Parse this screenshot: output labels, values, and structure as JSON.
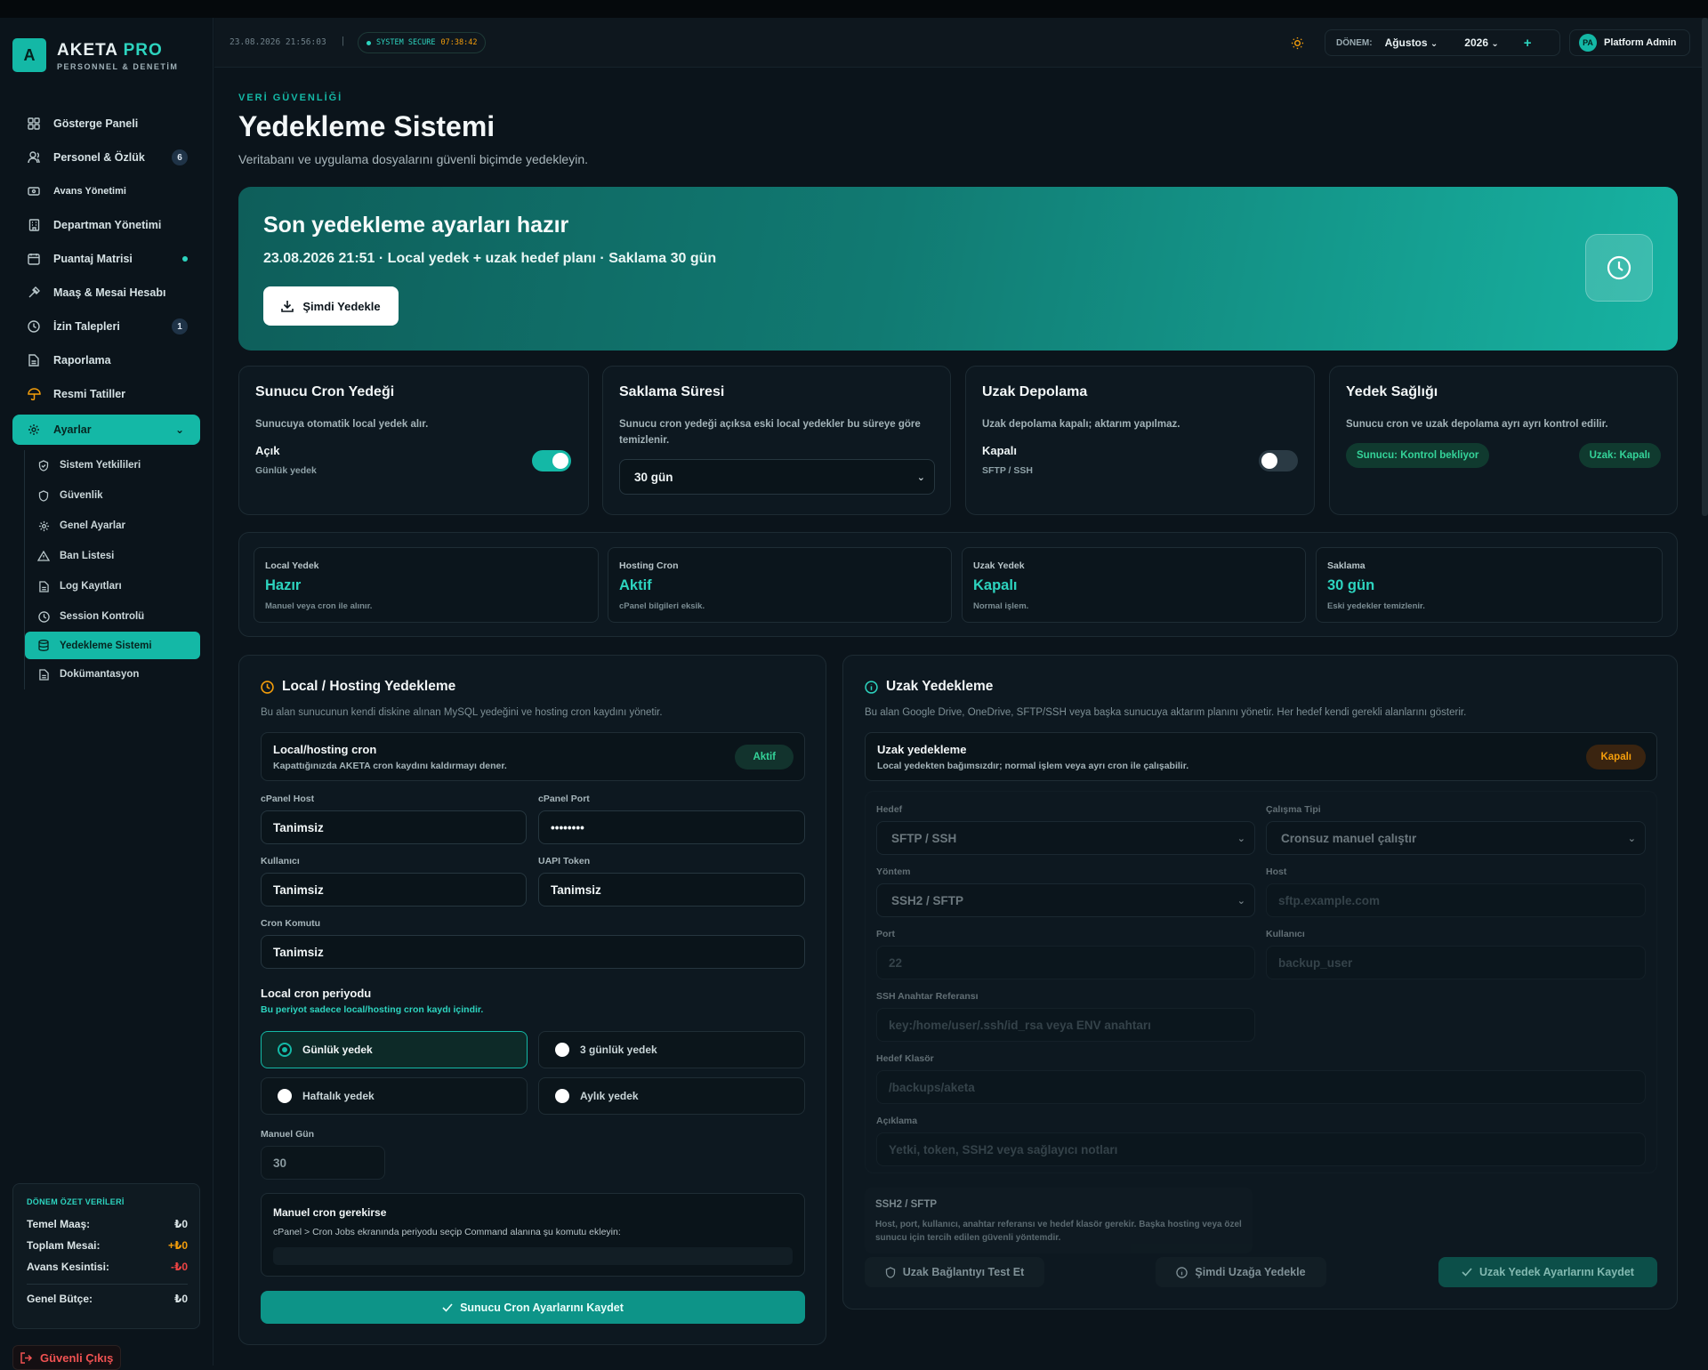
{
  "app": {
    "logo_letter": "A",
    "brand_name": "AKETA",
    "brand_pro": "PRO",
    "brand_sub": "PERSONNEL & DENETİM"
  },
  "sidebar": {
    "items": [
      {
        "label": "Gösterge Paneli",
        "icon": "grid-icon"
      },
      {
        "label": "Personel & Özlük",
        "icon": "users-icon",
        "badge": "6"
      },
      {
        "label": "Avans Yönetimi",
        "icon": "wallet-icon"
      },
      {
        "label": "Departman Yönetimi",
        "icon": "building-icon"
      },
      {
        "label": "Puantaj Matrisi",
        "icon": "calendar-icon"
      },
      {
        "label": "Maaş & Mesai Hesabı",
        "icon": "calculator-icon"
      },
      {
        "label": "İzin Talepleri",
        "icon": "clock-icon",
        "badge": "1"
      },
      {
        "label": "Raporlama",
        "icon": "file-icon"
      },
      {
        "label": "Resmi Tatiller",
        "icon": "umbrella-icon"
      },
      {
        "label": "Ayarlar",
        "icon": "gear-icon",
        "chevron": "⌄"
      }
    ],
    "sub_items": [
      {
        "label": "Sistem Yetkilileri",
        "icon": "shield-icon"
      },
      {
        "label": "Güvenlik",
        "icon": "shield-icon"
      },
      {
        "label": "Genel Ayarlar",
        "icon": "gear-icon"
      },
      {
        "label": "Ban Listesi",
        "icon": "warning-icon"
      },
      {
        "label": "Log Kayıtları",
        "icon": "file-icon"
      },
      {
        "label": "Session Kontrolü",
        "icon": "clock-icon"
      },
      {
        "label": "Yedekleme Sistemi",
        "icon": "database-icon"
      },
      {
        "label": "Dokümantasyon",
        "icon": "file-icon"
      }
    ],
    "summary": {
      "title": "DÖNEM ÖZET VERİLERİ",
      "rows": [
        {
          "label": "Temel Maaş:",
          "value": "₺0",
          "color": "#e6eef0"
        },
        {
          "label": "Toplam Mesai:",
          "value": "+₺0",
          "color": "#f59e0b"
        },
        {
          "label": "Avans Kesintisi:",
          "value": "-₺0",
          "color": "#ef4444"
        }
      ],
      "total_label": "Genel Bütçe:",
      "total_value": "₺0"
    },
    "logout": "Güvenli Çıkış"
  },
  "header": {
    "datetime": "23.08.2026 21:56:03",
    "separator": "|",
    "secure_label": "SYSTEM SECURE",
    "secure_timer": "07:38:42",
    "period_label": "DÖNEM:",
    "month": "Ağustos",
    "year": "2026",
    "plus": "+",
    "avatar": "PA",
    "user": "Platform Admin"
  },
  "page": {
    "kicker": "VERİ GÜVENLİĞİ",
    "title": "Yedekleme Sistemi",
    "subtitle": "Veritabanı ve uygulama dosyalarını güvenli biçimde yedekleyin."
  },
  "hero": {
    "title": "Son yedekleme ayarları hazır",
    "subtitle": "23.08.2026 21:51 · Local yedek + uzak hedef planı · Saklama 30 gün",
    "button": "Şimdi Yedekle"
  },
  "cards": {
    "cron": {
      "title": "Sunucu Cron Yedeği",
      "desc": "Sunucuya otomatik local yedek alır.",
      "status": "Açık",
      "status_sub": "Günlük yedek",
      "toggle_on": true
    },
    "retention": {
      "title": "Saklama Süresi",
      "desc": "Sunucu cron yedeği açıksa eski local yedekler bu süreye göre temizlenir.",
      "select": "30 gün"
    },
    "remote": {
      "title": "Uzak Depolama",
      "desc": "Uzak depolama kapalı; aktarım yapılmaz.",
      "status": "Kapalı",
      "status_sub": "SFTP / SSH",
      "toggle_on": false
    },
    "health": {
      "title": "Yedek Sağlığı",
      "desc": "Sunucu cron ve uzak depolama ayrı ayrı kontrol edilir.",
      "pill1": "Sunucu: Kontrol bekliyor",
      "pill2": "Uzak: Kapalı"
    }
  },
  "stats": [
    {
      "label": "Local Yedek",
      "value": "Hazır",
      "sub": "Manuel veya cron ile alınır."
    },
    {
      "label": "Hosting Cron",
      "value": "Aktif",
      "sub": "cPanel bilgileri eksik."
    },
    {
      "label": "Uzak Yedek",
      "value": "Kapalı",
      "sub": "Normal işlem."
    },
    {
      "label": "Saklama",
      "value": "30 gün",
      "sub": "Eski yedekler temizlenir."
    }
  ],
  "local": {
    "title": "Local / Hosting Yedekleme",
    "desc": "Bu alan sunucunun kendi diskine alınan MySQL yedeğini ve hosting cron kaydını yönetir.",
    "cron_box_title": "Local/hosting cron",
    "cron_box_desc": "Kapattığınızda AKETA cron kaydını kaldırmayı dener.",
    "cron_badge": "Aktif",
    "fields": {
      "cpanel_host_label": "cPanel Host",
      "cpanel_host": "Tanimsiz",
      "cpanel_port_label": "cPanel Port",
      "cpanel_port": "••••••••",
      "user_label": "Kullanıcı",
      "user": "Tanimsiz",
      "token_label": "UAPI Token",
      "token": "Tanimsiz",
      "command_label": "Cron Komutu",
      "command": "Tanimsiz"
    },
    "period_title": "Local cron periyodu",
    "period_desc": "Bu periyot sadece local/hosting cron kaydı içindir.",
    "options": [
      "Günlük yedek",
      "3 günlük yedek",
      "Haftalık yedek",
      "Aylık yedek"
    ],
    "manual_label": "Manuel Gün",
    "manual_value": "30",
    "manual_box_title": "Manuel cron gerekirse",
    "manual_box_desc": "cPanel > Cron Jobs ekranında periyodu seçip Command alanına şu komutu ekleyin:",
    "save": "Sunucu Cron Ayarlarını Kaydet"
  },
  "remote": {
    "title": "Uzak Yedekleme",
    "desc": "Bu alan Google Drive, OneDrive, SFTP/SSH veya başka sunucuya aktarım planını yönetir. Her hedef kendi gerekli alanlarını gösterir.",
    "box_title": "Uzak yedekleme",
    "box_desc": "Local yedekten bağımsızdır; normal işlem veya ayrı cron ile çalışabilir.",
    "badge": "Kapalı",
    "target_label": "Hedef",
    "target": "SFTP / SSH",
    "mode_label": "Çalışma Tipi",
    "mode": "Cronsuz manuel çalıştır",
    "method_label": "Yöntem",
    "method": "SSH2 / SFTP",
    "host_label": "Host",
    "host_ph": "sftp.example.com",
    "port_label": "Port",
    "port_ph": "22",
    "user_label": "Kullanıcı",
    "user_ph": "backup_user",
    "key_label": "SSH Anahtar Referansı",
    "key_ph": "key:/home/user/.ssh/id_rsa veya ENV anahtarı",
    "folder_label": "Hedef Klasör",
    "folder_ph": "/backups/aketa",
    "note_label": "Açıklama",
    "note_ph": "Yetki, token, SSH2 veya sağlayıcı notları",
    "info_title": "SSH2 / SFTP",
    "info_desc": "Host, port, kullanıcı, anahtar referansı ve hedef klasör gerekir. Başka hosting veya özel sunucu için tercih edilen güvenli yöntemdir.",
    "btn_test": "Uzak Bağlantıyı Test Et",
    "btn_backup": "Şimdi Uzağa Yedekle",
    "btn_save": "Uzak Yedek Ayarlarını Kaydet"
  },
  "colors": {
    "accent": "#14b8a6",
    "danger": "#ef4444",
    "warning": "#f59e0b",
    "bg": "#0b141b"
  }
}
